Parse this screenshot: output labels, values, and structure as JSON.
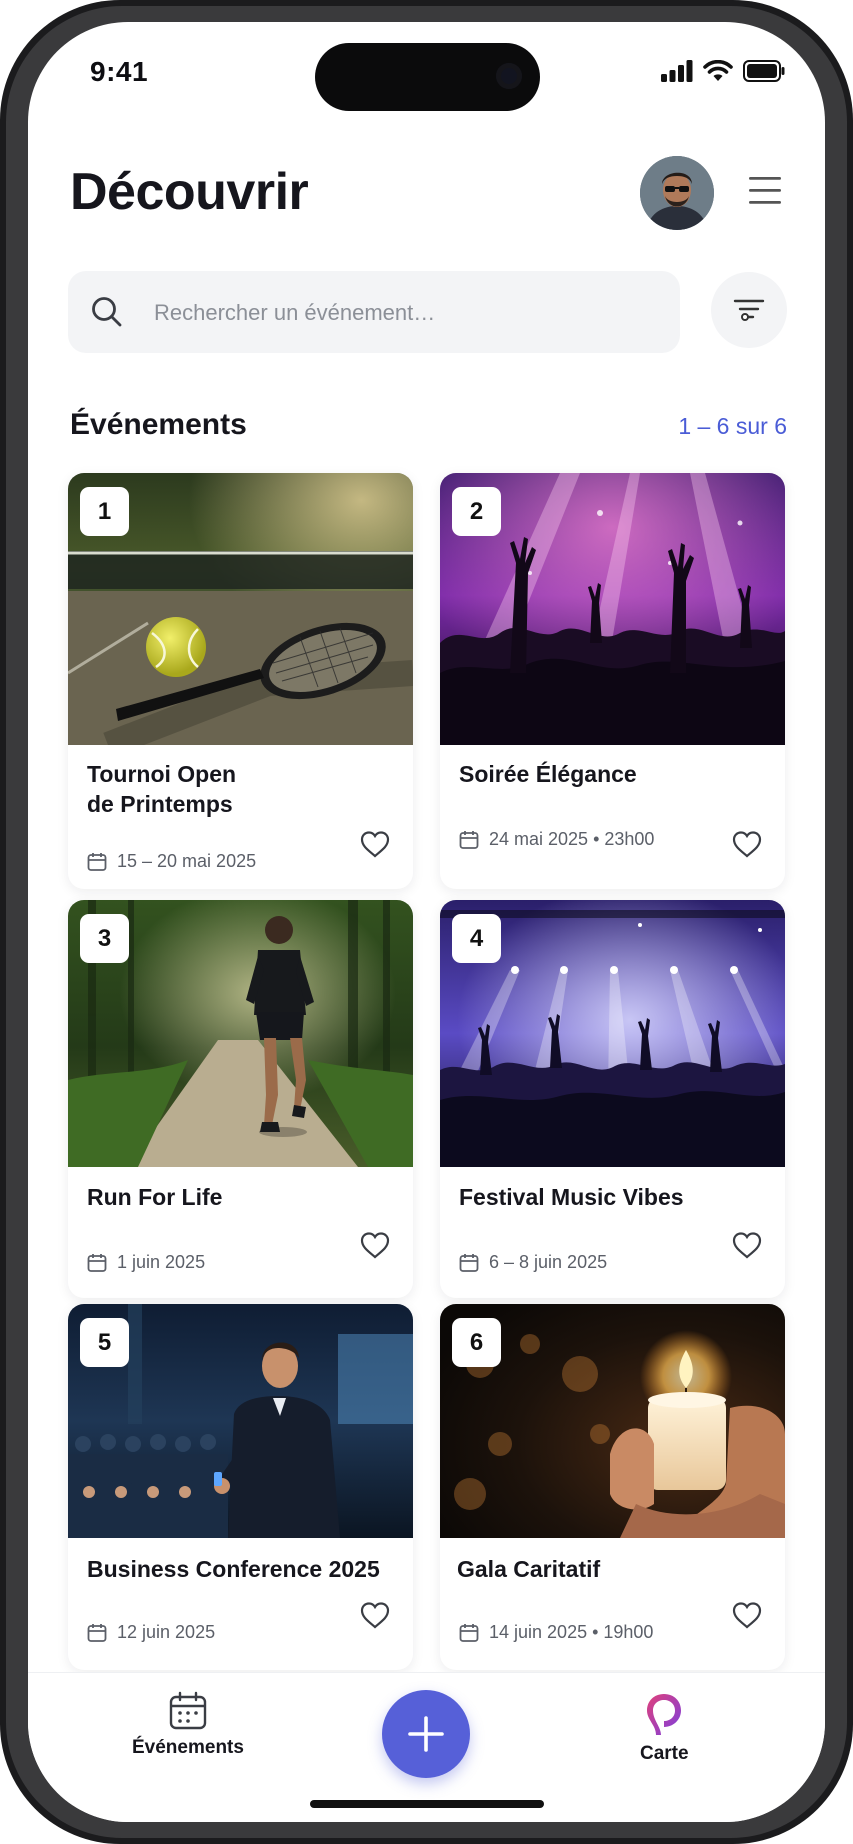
{
  "status_bar": {
    "time": "9:41"
  },
  "header": {
    "title": "Découvrir"
  },
  "search": {
    "placeholder": "Rechercher un événement…"
  },
  "section": {
    "title": "Événements",
    "count": "1 – 6 sur 6"
  },
  "events": [
    {
      "number": "1",
      "title": "Tournoi Open\nde Printemps",
      "date": "15 – 20 mai 2025",
      "image": "tennis racket and ball on court"
    },
    {
      "number": "2",
      "title": "Soirée Élégance",
      "date": "24 mai 2025 • 23h00",
      "image": "concert crowd with purple lights"
    },
    {
      "number": "3",
      "title": "Run For Life",
      "date": "1 juin 2025",
      "image": "runner on forest path"
    },
    {
      "number": "4",
      "title": "Festival Music Vibes",
      "date": "6 – 8 juin 2025",
      "image": "festival stage with crowd"
    },
    {
      "number": "5",
      "title": "Business Conference 2025",
      "date": "12 juin 2025",
      "image": "speaker presenting to audience"
    },
    {
      "number": "6",
      "title": "Gala Caritatif",
      "date": "14 juin 2025 • 19h00",
      "image": "hands holding a lit candle"
    }
  ],
  "tabbar": {
    "events_label": "Événements",
    "map_label": "Carte"
  },
  "icons": [
    "search-icon",
    "filter-icon",
    "menu-icon",
    "calendar-icon",
    "heart-icon",
    "plus-icon",
    "map-pin-icon",
    "signal-icon",
    "wifi-icon",
    "battery-icon"
  ],
  "colors": {
    "accent": "#5660d8",
    "link": "#4a5cd6",
    "map_pin_gradient": [
      "#e0407a",
      "#7b3fe0"
    ]
  }
}
